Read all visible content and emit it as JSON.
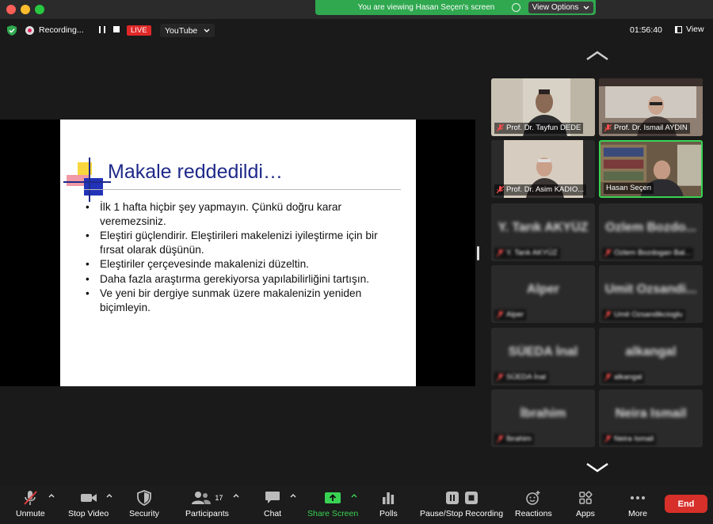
{
  "window": {
    "viewing_banner": "You are viewing Hasan Seçen's screen",
    "view_options": "View Options"
  },
  "topbar": {
    "recording": "Recording...",
    "live": "LIVE",
    "stream_target": "YouTube",
    "clock": "01:56:40",
    "view": "View"
  },
  "slide": {
    "title": "Makale reddedildi…",
    "bullets": [
      "İlk 1 hafta hiçbir şey yapmayın. Çünkü doğru karar veremezsiniz.",
      "Eleştiri güçlendirir. Eleştirileri makelenizi iyileştirme için   bir fırsat  olarak düşünün.",
      "Eleştiriler çerçevesinde makalenizi düzeltin.",
      "Daha fazla araştırma gerekiyorsa yapılabilirliğini tartışın.",
      "Ve yeni bir dergiye sunmak üzere makalenizin yeniden biçimleyin."
    ]
  },
  "participants": [
    {
      "name": "Prof. Dr. Tayfun DEDE",
      "video": true,
      "muted": true
    },
    {
      "name": "Prof. Dr. Ismail AYDIN",
      "video": true,
      "muted": true
    },
    {
      "name": "Prof. Dr. Asim KADIO...",
      "video": true,
      "muted": true
    },
    {
      "name": "Hasan Seçen",
      "video": true,
      "muted": false,
      "active": true
    },
    {
      "name": "Y. Tarık AKYÜZ",
      "label": "Y. Tarık AKYÜZ",
      "video": false,
      "muted": true
    },
    {
      "name": "Ozlem Bozdo...",
      "label": "Ozlem Bozdogan Bal...",
      "video": false,
      "muted": true
    },
    {
      "name": "Alper",
      "label": "Alper",
      "video": false,
      "muted": true
    },
    {
      "name": "Umit Ozsandi...",
      "label": "Umit Ozsandikcioglu",
      "video": false,
      "muted": true
    },
    {
      "name": "SÜEDA İnal",
      "label": "SÜEDA İnal",
      "video": false,
      "muted": true
    },
    {
      "name": "alkangal",
      "label": "alkangal",
      "video": false,
      "muted": true
    },
    {
      "name": "İbrahim",
      "label": "İbrahim",
      "video": false,
      "muted": true
    },
    {
      "name": "Neira Ismail",
      "label": "Neira Ismail",
      "video": false,
      "muted": true
    }
  ],
  "toolbar": {
    "unmute": "Unmute",
    "stop_video": "Stop Video",
    "security": "Security",
    "participants": "Participants",
    "participants_count": "17",
    "chat": "Chat",
    "share_screen": "Share Screen",
    "polls": "Polls",
    "pause_stop_recording": "Pause/Stop Recording",
    "reactions": "Reactions",
    "apps": "Apps",
    "more": "More",
    "end": "End"
  },
  "colors": {
    "accent_green": "#39d353",
    "live_red": "#e02828",
    "end_red": "#d7302a",
    "slide_title_blue": "#1f2a8a"
  }
}
